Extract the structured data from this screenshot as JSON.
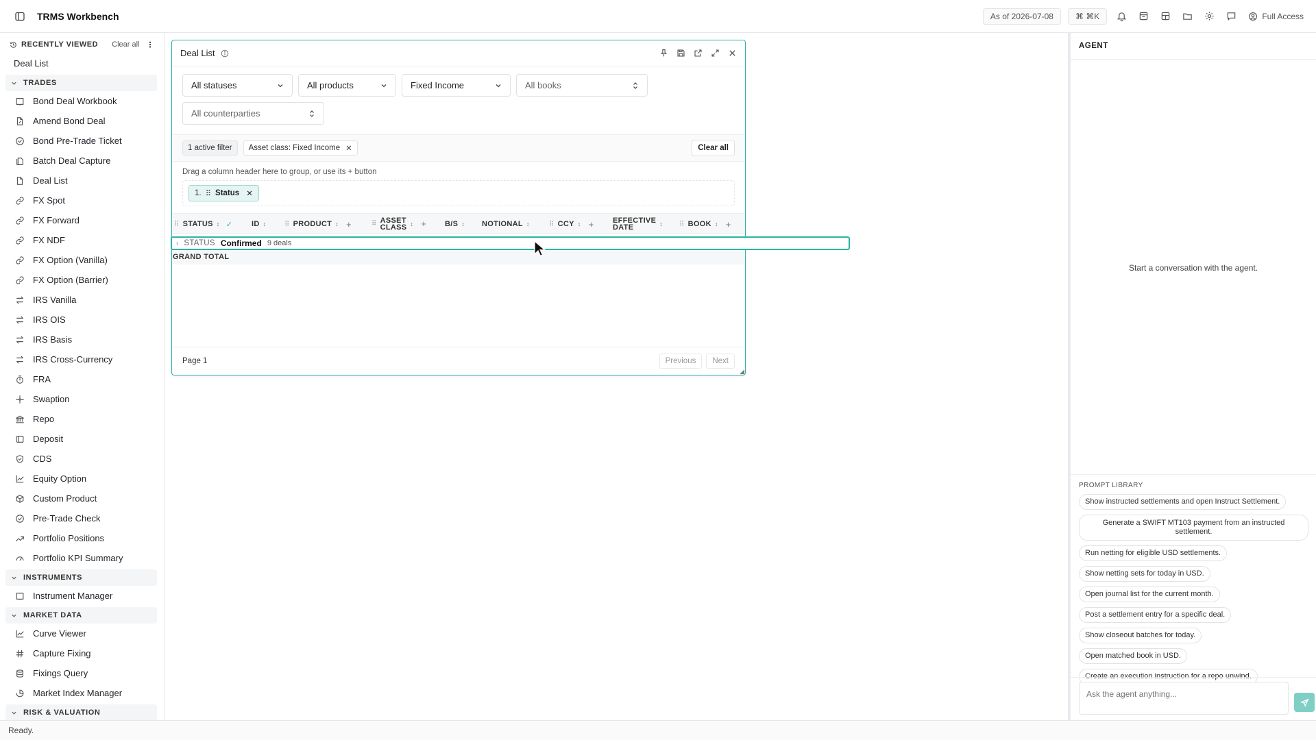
{
  "app": {
    "title": "TRMS Workbench"
  },
  "topbar": {
    "as_of": "As of 2026-07-08",
    "shortcut": "⌘ ⌘K",
    "access": "Full Access"
  },
  "sidebar": {
    "recent_title": "RECENTLY VIEWED",
    "clear_all": "Clear all",
    "recent_items": [
      "Deal List"
    ],
    "sections": [
      {
        "title": "TRADES",
        "items": [
          {
            "label": "Bond Deal Workbook",
            "icon": "book-icon"
          },
          {
            "label": "Amend Bond Deal",
            "icon": "file-edit-icon"
          },
          {
            "label": "Bond Pre-Trade Ticket",
            "icon": "check-circle-icon"
          },
          {
            "label": "Batch Deal Capture",
            "icon": "file-stack-icon"
          },
          {
            "label": "Deal List",
            "icon": "file-icon"
          },
          {
            "label": "FX Spot",
            "icon": "link-icon"
          },
          {
            "label": "FX Forward",
            "icon": "link-icon"
          },
          {
            "label": "FX NDF",
            "icon": "link-icon"
          },
          {
            "label": "FX Option (Vanilla)",
            "icon": "link-icon"
          },
          {
            "label": "FX Option (Barrier)",
            "icon": "link-icon"
          },
          {
            "label": "IRS Vanilla",
            "icon": "swap-icon"
          },
          {
            "label": "IRS OIS",
            "icon": "swap-icon"
          },
          {
            "label": "IRS Basis",
            "icon": "swap-icon"
          },
          {
            "label": "IRS Cross-Currency",
            "icon": "swap-icon"
          },
          {
            "label": "FRA",
            "icon": "timer-icon"
          },
          {
            "label": "Swaption",
            "icon": "sparkle-icon"
          },
          {
            "label": "Repo",
            "icon": "bank-icon"
          },
          {
            "label": "Deposit",
            "icon": "deposit-icon"
          },
          {
            "label": "CDS",
            "icon": "shield-icon"
          },
          {
            "label": "Equity Option",
            "icon": "chart-line-icon"
          },
          {
            "label": "Custom Product",
            "icon": "cube-icon"
          },
          {
            "label": "Pre-Trade Check",
            "icon": "check-circle-icon"
          },
          {
            "label": "Portfolio Positions",
            "icon": "trend-icon"
          },
          {
            "label": "Portfolio KPI Summary",
            "icon": "gauge-icon"
          }
        ]
      },
      {
        "title": "INSTRUMENTS",
        "items": [
          {
            "label": "Instrument Manager",
            "icon": "book-icon"
          }
        ]
      },
      {
        "title": "MARKET DATA",
        "items": [
          {
            "label": "Curve Viewer",
            "icon": "chart-line-icon"
          },
          {
            "label": "Capture Fixing",
            "icon": "hash-icon"
          },
          {
            "label": "Fixings Query",
            "icon": "database-icon"
          },
          {
            "label": "Market Index Manager",
            "icon": "index-icon"
          }
        ]
      },
      {
        "title": "RISK & VALUATION",
        "items": []
      }
    ]
  },
  "deal_list": {
    "title": "Deal List",
    "filters": {
      "status": "All statuses",
      "product": "All products",
      "asset_class": "Fixed Income",
      "book": "All books",
      "counterparty": "All counterparties"
    },
    "active_filter_count": "1 active filter",
    "active_filter_chip": "Asset class: Fixed Income",
    "clear_all": "Clear all",
    "group_hint": "Drag a column header here to group, or use its + button",
    "group_chip_index": "1.",
    "group_chip_label": "Status",
    "columns": {
      "status": "STATUS",
      "id": "ID",
      "product": "PRODUCT",
      "asset_class_1": "ASSET",
      "asset_class_2": "CLASS",
      "bs": "B/S",
      "notional": "NOTIONAL",
      "ccy": "CCY",
      "effective_date_1": "EFFECTIVE",
      "effective_date_2": "DATE",
      "book": "BOOK"
    },
    "group_row": {
      "label": "STATUS",
      "value": "Confirmed",
      "count": "9 deals"
    },
    "grand_total": "GRAND TOTAL",
    "footer": {
      "page": "Page 1",
      "previous": "Previous",
      "next": "Next"
    }
  },
  "agent": {
    "title": "AGENT",
    "empty": "Start a conversation with the agent.",
    "prompt_library_title": "PROMPT LIBRARY",
    "prompts": [
      "Show instructed settlements and open Instruct Settlement.",
      "Generate a SWIFT MT103 payment from an instructed settlement.",
      "Run netting for eligible USD settlements.",
      "Show netting sets for today in USD.",
      "Open journal list for the current month.",
      "Post a settlement entry for a specific deal.",
      "Show closeout batches for today.",
      "Open matched book in USD.",
      "Create an execution instruction for a repo unwind."
    ],
    "input_placeholder": "Ask the agent anything..."
  },
  "statusbar": {
    "text": "Ready."
  },
  "colors": {
    "accent": "#2bb3a6",
    "send": "#7fcfc5"
  }
}
